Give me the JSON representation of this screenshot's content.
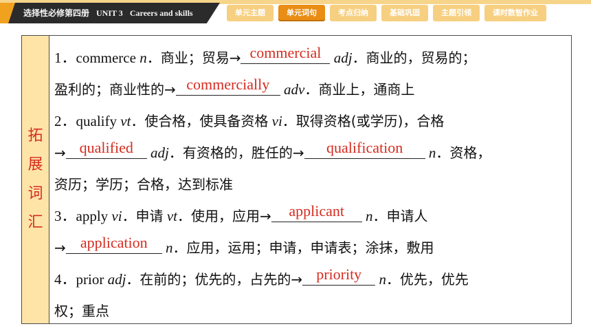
{
  "header": {
    "book": "选择性必修第四册",
    "unit": "UNIT 3",
    "unit_title": "Careers and skills",
    "tabs": [
      {
        "label": "单元主题",
        "active": false
      },
      {
        "label": "单元词句",
        "active": true
      },
      {
        "label": "考点归纳",
        "active": false
      },
      {
        "label": "基础巩固",
        "active": false
      },
      {
        "label": "主题引领",
        "active": false
      },
      {
        "label": "课时数智作业",
        "active": false
      }
    ]
  },
  "side_label": [
    "拓",
    "展",
    "词",
    "汇"
  ],
  "entries": {
    "e1": {
      "num": "1．",
      "word": "commerce",
      "pos": "n",
      "meaning": "．商业；贸易→",
      "ans1": "commercial",
      "pos2": "adj",
      "meaning2a": "．商业的，贸易的；",
      "meaning2b": "盈利的；商业性的→",
      "ans2": "commercially",
      "pos3": "adv",
      "meaning3": "．商业上，通商上"
    },
    "e2": {
      "num": "2．",
      "word": "qualify",
      "pos": "vt",
      "meaning": "．使合格，使具备资格",
      "pos_b": "vi",
      "meaning_b": "．取得资格(或学历)，合格",
      "ans1": "qualified",
      "pos2": "adj",
      "meaning2": "．有资格的，胜任的→",
      "ans2": "qualification",
      "pos3": "n",
      "meaning3a": "．资格，",
      "meaning3b": "资历；学历；合格，达到标准"
    },
    "e3": {
      "num": "3．",
      "word": "apply",
      "pos": "vi",
      "meaning": "．申请",
      "pos_b": "vt",
      "meaning_b": "．使用，应用→",
      "ans1": "applicant",
      "pos2": "n",
      "meaning2": "．申请人",
      "ans2": "application",
      "pos3": "n",
      "meaning3": "．应用，运用；申请，申请表；涂抹，敷用"
    },
    "e4": {
      "num": "4．",
      "word": "prior",
      "pos": "adj",
      "meaning": "．在前的；优先的，占先的→",
      "ans1": "priority",
      "pos2": "n",
      "meaning2a": "．优先，优先",
      "meaning2b": "权；重点"
    }
  },
  "colors": {
    "answer": "#d62b1f",
    "side_bg": "#ffe4a8",
    "tab_bg": "#f7cf80",
    "tab_active": "#e98d14",
    "title_bar": "#2b2b2b"
  }
}
